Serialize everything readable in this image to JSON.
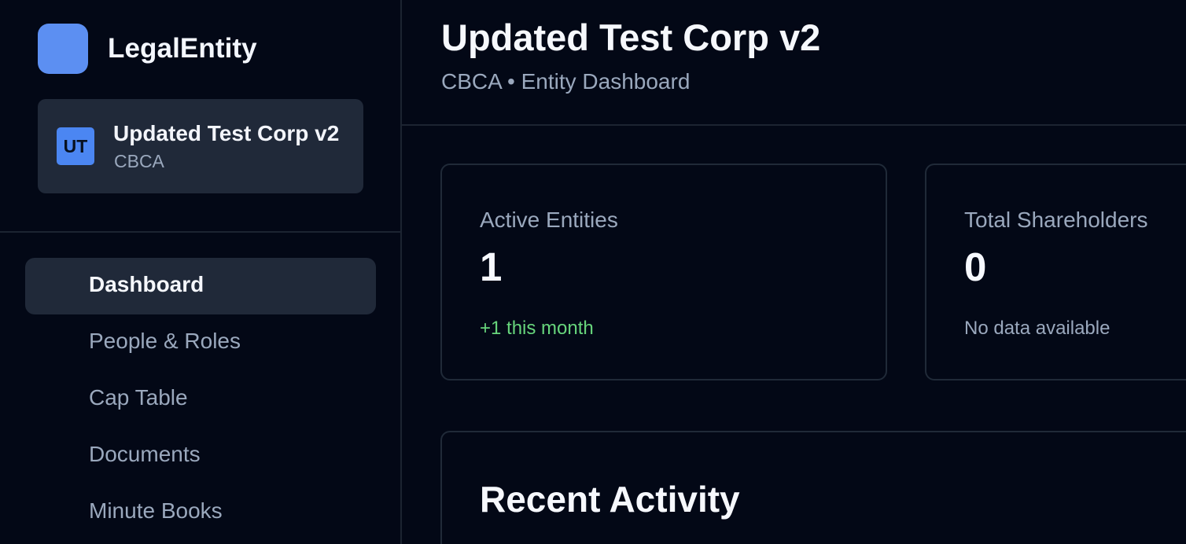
{
  "sidebar": {
    "brand": {
      "name": "LegalEntity",
      "logo_color": "#5c8ff2"
    },
    "entity": {
      "initials": "UT",
      "name": "Updated Test Corp v2",
      "type": "CBCA"
    },
    "items": [
      {
        "label": "Dashboard",
        "active": true
      },
      {
        "label": "People & Roles",
        "active": false
      },
      {
        "label": "Cap Table",
        "active": false
      },
      {
        "label": "Documents",
        "active": false
      },
      {
        "label": "Minute Books",
        "active": false
      }
    ]
  },
  "header": {
    "title": "Updated Test Corp v2",
    "subtitle": "CBCA • Entity Dashboard"
  },
  "stats": [
    {
      "label": "Active Entities",
      "value": "1",
      "note": "+1 this month",
      "note_color": "#67d57c"
    },
    {
      "label": "Total Shareholders",
      "value": "0",
      "note": "No data available",
      "note_color": "#9aa8bd"
    }
  ],
  "activity": {
    "title": "Recent Activity"
  },
  "colors": {
    "background": "#030816",
    "panel": "#202939",
    "muted_text": "#9aa8bd",
    "accent": "#4b86f2",
    "success": "#67d57c"
  }
}
